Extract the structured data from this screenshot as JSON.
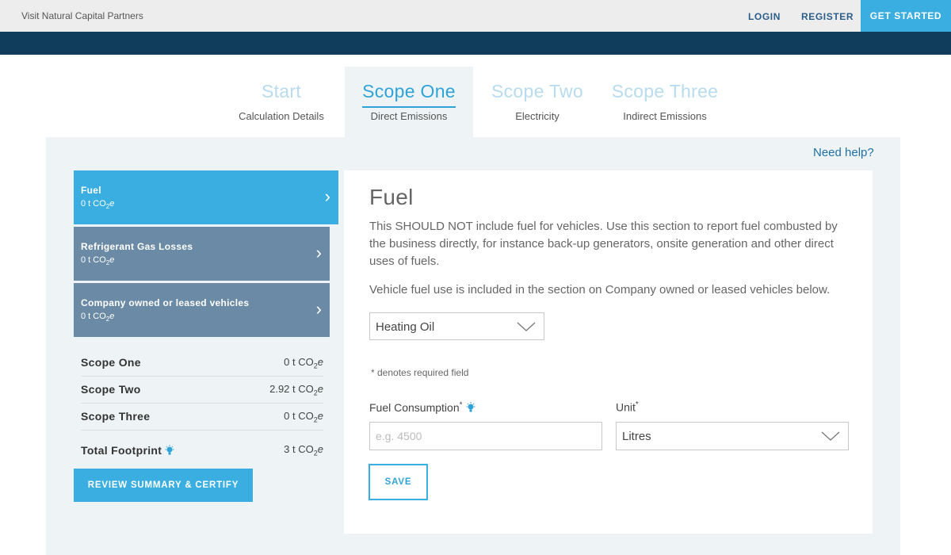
{
  "topbar": {
    "visit_link": "Visit Natural Capital Partners",
    "login": "LOGIN",
    "register": "REGISTER",
    "get_started": "GET STARTED"
  },
  "tabs": [
    {
      "title": "Start",
      "subtitle": "Calculation Details",
      "active": false
    },
    {
      "title": "Scope One",
      "subtitle": "Direct Emissions",
      "active": true
    },
    {
      "title": "Scope Two",
      "subtitle": "Electricity",
      "active": false
    },
    {
      "title": "Scope Three",
      "subtitle": "Indirect Emissions",
      "active": false
    }
  ],
  "help_link": "Need help?",
  "categories": [
    {
      "name": "Fuel",
      "value": "0 t CO",
      "sub": "2",
      "unit_suffix": "e",
      "active": true
    },
    {
      "name": "Refrigerant Gas Losses",
      "value": "0 t CO",
      "sub": "2",
      "unit_suffix": "e",
      "active": false
    },
    {
      "name": "Company owned or leased vehicles",
      "value": "0 t CO",
      "sub": "2",
      "unit_suffix": "e",
      "active": false
    }
  ],
  "summary": [
    {
      "label": "Scope One",
      "value": "0 t CO",
      "sub": "2",
      "suffix": "e"
    },
    {
      "label": "Scope Two",
      "value": "2.92 t CO",
      "sub": "2",
      "suffix": "e"
    },
    {
      "label": "Scope Three",
      "value": "0 t CO",
      "sub": "2",
      "suffix": "e"
    }
  ],
  "total": {
    "label": "Total Footprint",
    "value": "3 t CO",
    "sub": "2",
    "suffix": "e"
  },
  "review_button": "REVIEW SUMMARY & CERTIFY",
  "form": {
    "title": "Fuel",
    "description": "This SHOULD NOT include fuel for vehicles. Use this section to report fuel combusted by the business directly, for instance back-up generators, onsite generation and other direct uses of fuels.",
    "note": "Vehicle fuel use is included in the section on Company owned or leased vehicles below.",
    "fuel_type_selected": "Heating Oil",
    "required_note": "* denotes required field",
    "consumption_label": "Fuel Consumption",
    "consumption_required_mark": "*",
    "consumption_placeholder": "e.g. 4500",
    "consumption_value": "",
    "unit_label": "Unit",
    "unit_required_mark": "*",
    "unit_selected": "Litres",
    "save_button": "SAVE"
  },
  "colors": {
    "accent": "#3aaee0",
    "navy": "#103d5c",
    "slate": "#6a8aa6",
    "panel_bg": "#eef4f5"
  }
}
